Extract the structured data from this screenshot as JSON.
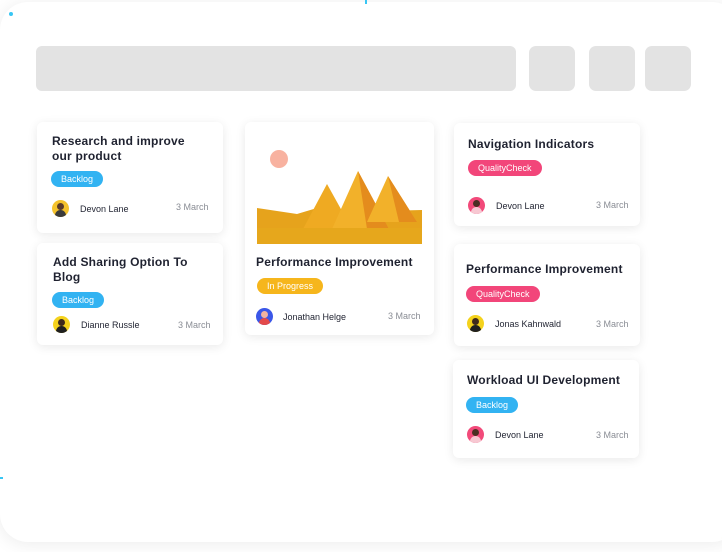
{
  "colors": {
    "backlog": "#32b3f2",
    "quality_check": "#f2467a",
    "in_progress": "#f6b61c"
  },
  "cards": {
    "c1": {
      "title": "Research and improve our product",
      "tag": "Backlog",
      "assignee": "Devon Lane",
      "date": "3 March"
    },
    "c2": {
      "title": "Add Sharing Option To Blog",
      "tag": "Backlog",
      "assignee": "Dianne Russle",
      "date": "3 March"
    },
    "c3": {
      "title": "Performance Improvement",
      "tag": "In Progress",
      "assignee": "Jonathan Helge",
      "date": "3 March",
      "image": "pyramids-illustration"
    },
    "c4": {
      "title": "Navigation Indicators",
      "tag": "QualityCheck",
      "assignee": "Devon Lane",
      "date": "3 March"
    },
    "c5": {
      "title": "Performance Improvement",
      "tag": "QualityCheck",
      "assignee": "Jonas Kahnwald",
      "date": "3 March"
    },
    "c6": {
      "title": "Workload UI Development",
      "tag": "Backlog",
      "assignee": "Devon Lane",
      "date": "3 March"
    }
  },
  "toolbar": {
    "search_icon": "search-bar",
    "buttons": [
      "filter-button",
      "sort-button",
      "more-button"
    ]
  }
}
